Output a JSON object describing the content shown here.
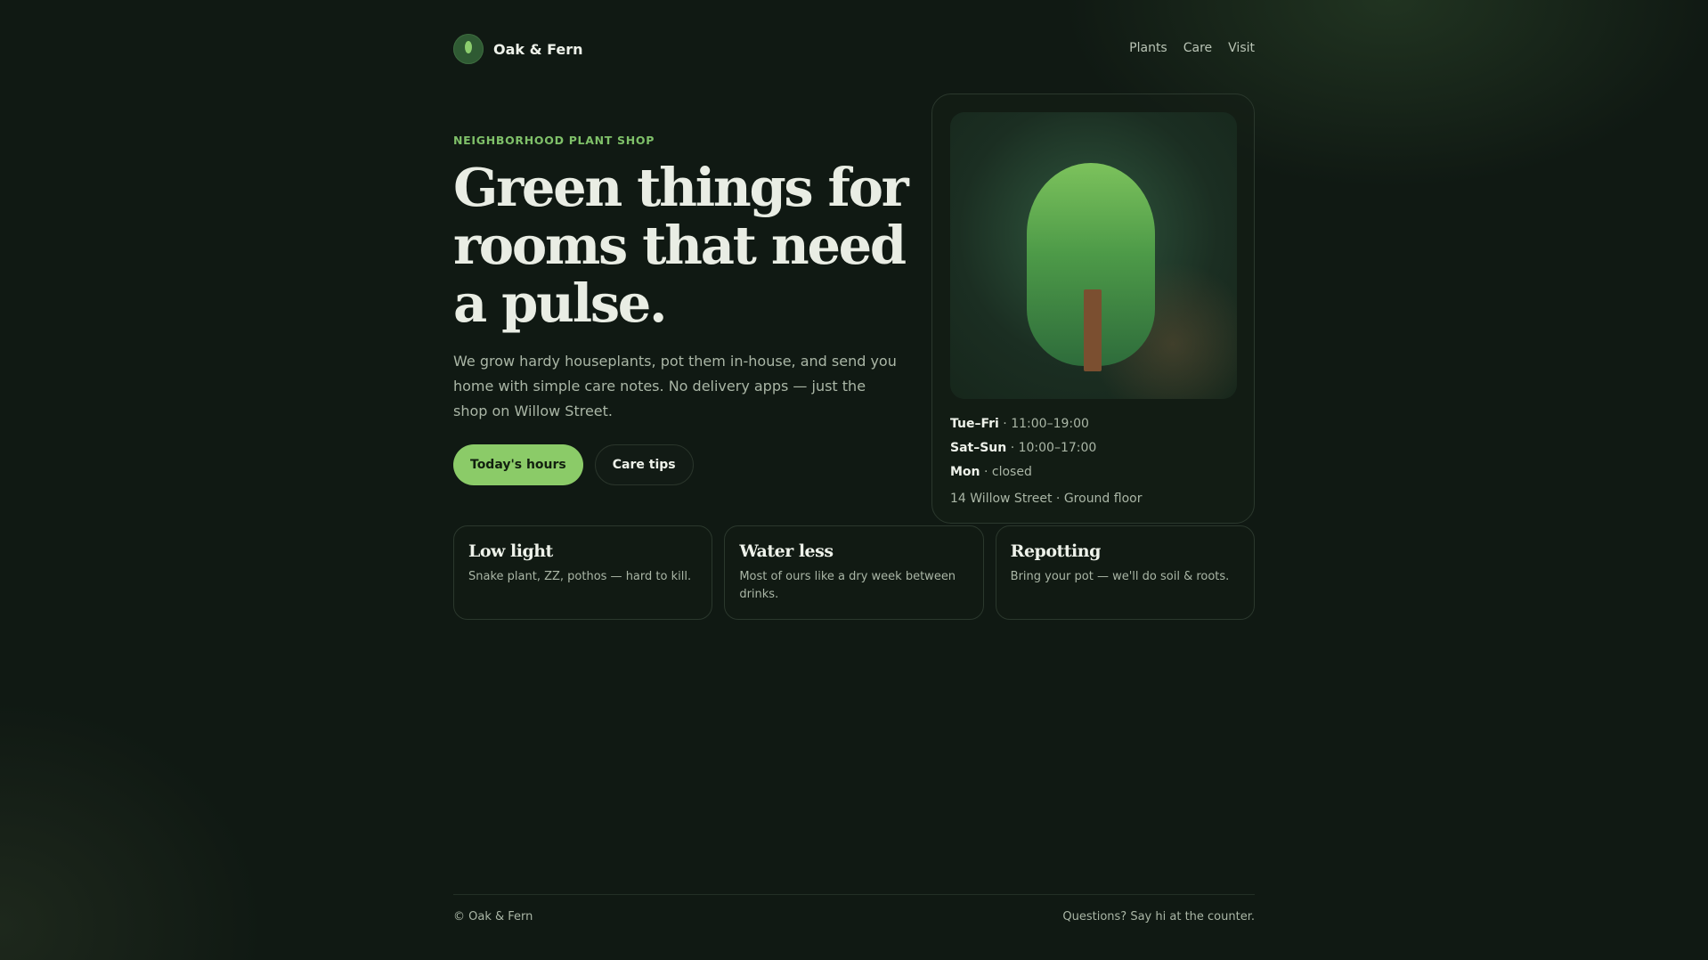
{
  "brand": {
    "name": "Oak & Fern",
    "logo_icon": "leaf-icon"
  },
  "nav": {
    "items": [
      "Plants",
      "Care",
      "Visit"
    ]
  },
  "hero": {
    "eyebrow": "NEIGHBORHOOD PLANT SHOP",
    "title": "Green things for rooms that need a pulse.",
    "subtitle": "We grow hardy houseplants, pot them in-house, and send you home with simple care notes. No delivery apps — just the shop on Willow Street.",
    "primary_button": "Today's hours",
    "secondary_button": "Care tips"
  },
  "card": {
    "illustration_icon": "tree-icon",
    "hours": [
      {
        "days": "Tue–Fri",
        "sep": " · ",
        "time": "11:00–19:00"
      },
      {
        "days": "Sat–Sun",
        "sep": " · ",
        "time": "10:00–17:00"
      },
      {
        "days": "Mon",
        "sep": " · ",
        "time": "closed"
      }
    ],
    "address": "14 Willow Street · Ground floor"
  },
  "features": [
    {
      "title": "Low light",
      "text": "Snake plant, ZZ, pothos — hard to kill."
    },
    {
      "title": "Water less",
      "text": "Most of ours like a dry week between drinks."
    },
    {
      "title": "Repotting",
      "text": "Bring your pot — we'll do soil & roots."
    }
  ],
  "footer": {
    "copyright": "© Oak & Fern",
    "note": "Questions? Say hi at the counter."
  },
  "colors": {
    "background": "#101913",
    "accent": "#8bcb68",
    "eyebrow": "#7fc069",
    "text": "#e9ede4",
    "muted": "#aab6a6"
  }
}
